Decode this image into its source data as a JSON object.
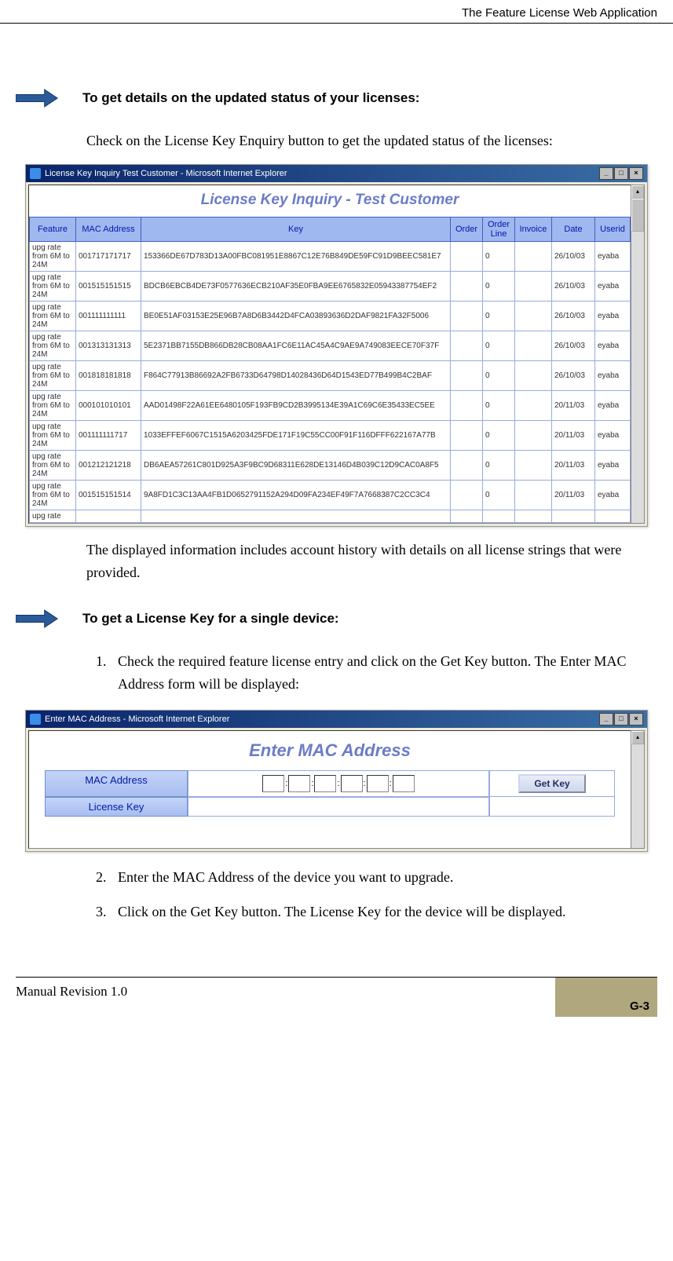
{
  "header": {
    "title": "The Feature License Web Application"
  },
  "note1": "To get details on the updated status of your licenses:",
  "body1": "Check on the License Key Enquiry button to get the updated status of the licenses:",
  "screenshot1": {
    "window_title": "License Key Inquiry Test Customer - Microsoft Internet Explorer",
    "page_title": "License Key Inquiry - Test Customer",
    "columns": [
      "Feature",
      "MAC Address",
      "Key",
      "Order",
      "Order Line",
      "Invoice",
      "Date",
      "Userid"
    ],
    "rows": [
      {
        "feature": "upg rate from 6M to 24M",
        "mac": "001717171717",
        "key": "153366DE67D783D13A00FBC081951E8867C12E76B849DE59FC91D9BEEC581E7",
        "order": "",
        "orderline": "0",
        "invoice": "",
        "date": "26/10/03",
        "userid": "eyaba"
      },
      {
        "feature": "upg rate from 6M to 24M",
        "mac": "001515151515",
        "key": "BDCB6EBCB4DE73F0577636ECB210AF35E0FBA9EE6765832E05943387754EF2",
        "order": "",
        "orderline": "0",
        "invoice": "",
        "date": "26/10/03",
        "userid": "eyaba"
      },
      {
        "feature": "upg rate from 6M to 24M",
        "mac": "001111111111",
        "key": "BE0E51AF03153E25E96B7A8D6B3442D4FCA03893636D2DAF9821FA32F5006",
        "order": "",
        "orderline": "0",
        "invoice": "",
        "date": "26/10/03",
        "userid": "eyaba"
      },
      {
        "feature": "upg rate from 6M to 24M",
        "mac": "001313131313",
        "key": "5E2371BB7155DB866DB28CB08AA1FC6E11AC45A4C9AE9A749083EECE70F37F",
        "order": "",
        "orderline": "0",
        "invoice": "",
        "date": "26/10/03",
        "userid": "eyaba"
      },
      {
        "feature": "upg rate from 6M to 24M",
        "mac": "001818181818",
        "key": "F864C77913B86692A2FB6733D64798D14028436D64D1543ED77B499B4C2BAF",
        "order": "",
        "orderline": "0",
        "invoice": "",
        "date": "26/10/03",
        "userid": "eyaba"
      },
      {
        "feature": "upg rate from 6M to 24M",
        "mac": "000101010101",
        "key": "AAD01498F22A61EE6480105F193FB9CD2B3995134E39A1C69C6E35433EC5EE",
        "order": "",
        "orderline": "0",
        "invoice": "",
        "date": "20/11/03",
        "userid": "eyaba"
      },
      {
        "feature": "upg rate from 6M to 24M",
        "mac": "001111111717",
        "key": "1033EFFEF6067C1515A6203425FDE171F19C55CC00F91F116DFFF622167A77B",
        "order": "",
        "orderline": "0",
        "invoice": "",
        "date": "20/11/03",
        "userid": "eyaba"
      },
      {
        "feature": "upg rate from 6M to 24M",
        "mac": "001212121218",
        "key": "DB6AEA57261C801D925A3F9BC9D68311E628DE13146D4B039C12D9CAC0A8F5",
        "order": "",
        "orderline": "0",
        "invoice": "",
        "date": "20/11/03",
        "userid": "eyaba"
      },
      {
        "feature": "upg rate from 6M to 24M",
        "mac": "001515151514",
        "key": "9A8FD1C3C13AA4FB1D0652791152A294D09FA234EF49F7A7668387C2CC3C4",
        "order": "",
        "orderline": "0",
        "invoice": "",
        "date": "20/11/03",
        "userid": "eyaba"
      },
      {
        "feature": "upg rate",
        "mac": "",
        "key": "",
        "order": "",
        "orderline": "",
        "invoice": "",
        "date": "",
        "userid": ""
      }
    ]
  },
  "body2": "The displayed information includes account history with details on all license strings that were provided.",
  "note2": "To get a License Key for a single device:",
  "step1": "Check the required feature license entry and click on the Get Key button. The Enter MAC Address form will be displayed:",
  "screenshot2": {
    "window_title": "Enter MAC Address - Microsoft Internet Explorer",
    "page_title": "Enter MAC Address",
    "label_mac": "MAC Address",
    "label_key": "License Key",
    "button": "Get Key"
  },
  "step2": "Enter the MAC Address of the device you want to upgrade.",
  "step3": "Click on the Get Key button. The License Key for the device will be displayed.",
  "footer": {
    "revision": "Manual Revision 1.0",
    "page": "G-3"
  }
}
